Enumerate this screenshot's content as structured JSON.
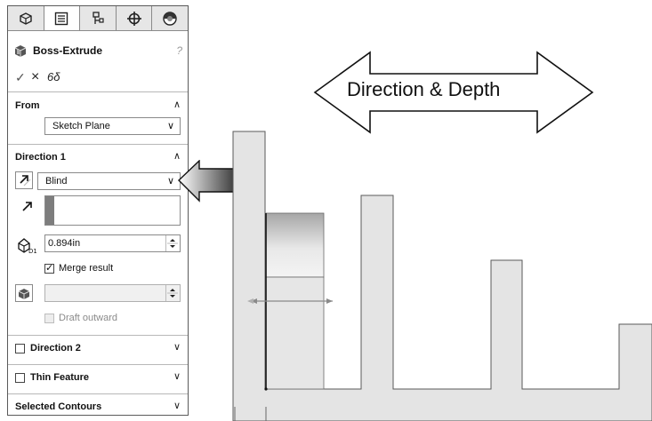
{
  "panel": {
    "tabs": [
      {
        "icon": "feature-manager-icon",
        "active": false
      },
      {
        "icon": "property-manager-icon",
        "active": true
      },
      {
        "icon": "configuration-manager-icon",
        "active": false
      },
      {
        "icon": "dimxpert-manager-icon",
        "active": false
      },
      {
        "icon": "display-manager-icon",
        "active": false
      }
    ],
    "title": "Boss-Extrude",
    "help": "?",
    "actions": {
      "ok": "✓",
      "cancel": "×",
      "preview": "6δ"
    },
    "from": {
      "label": "From",
      "selected": "Sketch Plane"
    },
    "direction1": {
      "label": "Direction 1",
      "end_condition": "Blind",
      "depth": "0.894in",
      "merge_result": {
        "label": "Merge result",
        "checked": true
      },
      "draft_outward": {
        "label": "Draft outward",
        "checked": false
      }
    },
    "direction2": {
      "label": "Direction 2",
      "checked": false
    },
    "thin_feature": {
      "label": "Thin Feature",
      "checked": false
    },
    "selected_contours": {
      "label": "Selected Contours"
    },
    "expand": "∨",
    "collapse": "∧",
    "dropdown": "∨"
  },
  "callout": {
    "label": "Direction & Depth"
  },
  "colors": {
    "part_fill": "#e4e4e4",
    "part_edge": "#5a5a5a",
    "accent_gray": "#7d7d7d"
  }
}
